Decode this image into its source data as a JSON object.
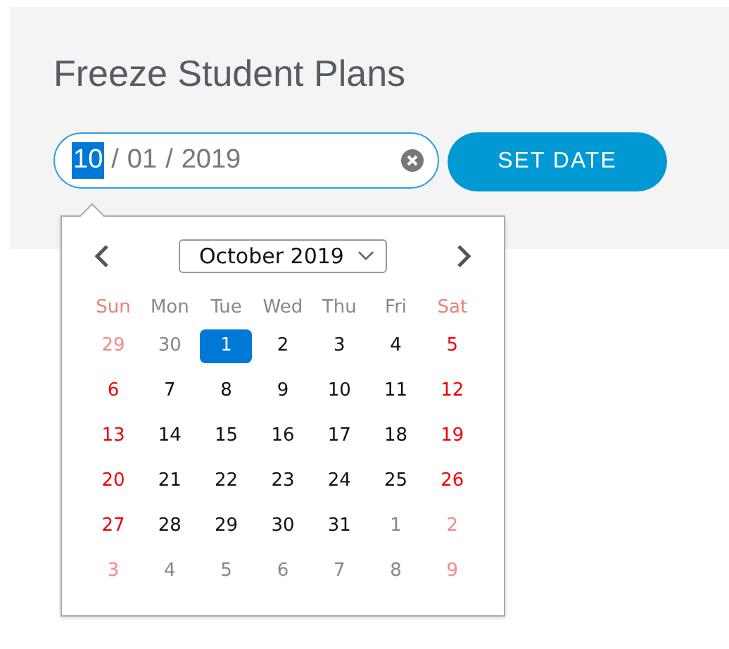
{
  "title": "Freeze Student Plans",
  "date_field": {
    "segments": [
      {
        "text": "10",
        "selected": true
      },
      {
        "text": "/",
        "selected": false
      },
      {
        "text": "01",
        "selected": false
      },
      {
        "text": "/",
        "selected": false
      },
      {
        "text": "2019",
        "selected": false
      }
    ]
  },
  "set_button": "SET DATE",
  "calendar": {
    "month": "October 2019",
    "weekdays": [
      "Sun",
      "Mon",
      "Tue",
      "Wed",
      "Thu",
      "Fri",
      "Sat"
    ],
    "weeks": [
      [
        {
          "day": "29",
          "outside": true,
          "selected": false
        },
        {
          "day": "30",
          "outside": true,
          "selected": false
        },
        {
          "day": "1",
          "outside": false,
          "selected": true
        },
        {
          "day": "2",
          "outside": false,
          "selected": false
        },
        {
          "day": "3",
          "outside": false,
          "selected": false
        },
        {
          "day": "4",
          "outside": false,
          "selected": false
        },
        {
          "day": "5",
          "outside": false,
          "selected": false
        }
      ],
      [
        {
          "day": "6",
          "outside": false,
          "selected": false
        },
        {
          "day": "7",
          "outside": false,
          "selected": false
        },
        {
          "day": "8",
          "outside": false,
          "selected": false
        },
        {
          "day": "9",
          "outside": false,
          "selected": false
        },
        {
          "day": "10",
          "outside": false,
          "selected": false
        },
        {
          "day": "11",
          "outside": false,
          "selected": false
        },
        {
          "day": "12",
          "outside": false,
          "selected": false
        }
      ],
      [
        {
          "day": "13",
          "outside": false,
          "selected": false
        },
        {
          "day": "14",
          "outside": false,
          "selected": false
        },
        {
          "day": "15",
          "outside": false,
          "selected": false
        },
        {
          "day": "16",
          "outside": false,
          "selected": false
        },
        {
          "day": "17",
          "outside": false,
          "selected": false
        },
        {
          "day": "18",
          "outside": false,
          "selected": false
        },
        {
          "day": "19",
          "outside": false,
          "selected": false
        }
      ],
      [
        {
          "day": "20",
          "outside": false,
          "selected": false
        },
        {
          "day": "21",
          "outside": false,
          "selected": false
        },
        {
          "day": "22",
          "outside": false,
          "selected": false
        },
        {
          "day": "23",
          "outside": false,
          "selected": false
        },
        {
          "day": "24",
          "outside": false,
          "selected": false
        },
        {
          "day": "25",
          "outside": false,
          "selected": false
        },
        {
          "day": "26",
          "outside": false,
          "selected": false
        }
      ],
      [
        {
          "day": "27",
          "outside": false,
          "selected": false
        },
        {
          "day": "28",
          "outside": false,
          "selected": false
        },
        {
          "day": "29",
          "outside": false,
          "selected": false
        },
        {
          "day": "30",
          "outside": false,
          "selected": false
        },
        {
          "day": "31",
          "outside": false,
          "selected": false
        },
        {
          "day": "1",
          "outside": true,
          "selected": false
        },
        {
          "day": "2",
          "outside": true,
          "selected": false
        }
      ],
      [
        {
          "day": "3",
          "outside": true,
          "selected": false
        },
        {
          "day": "4",
          "outside": true,
          "selected": false
        },
        {
          "day": "5",
          "outside": true,
          "selected": false
        },
        {
          "day": "6",
          "outside": true,
          "selected": false
        },
        {
          "day": "7",
          "outside": true,
          "selected": false
        },
        {
          "day": "8",
          "outside": true,
          "selected": false
        },
        {
          "day": "9",
          "outside": true,
          "selected": false
        }
      ]
    ]
  }
}
